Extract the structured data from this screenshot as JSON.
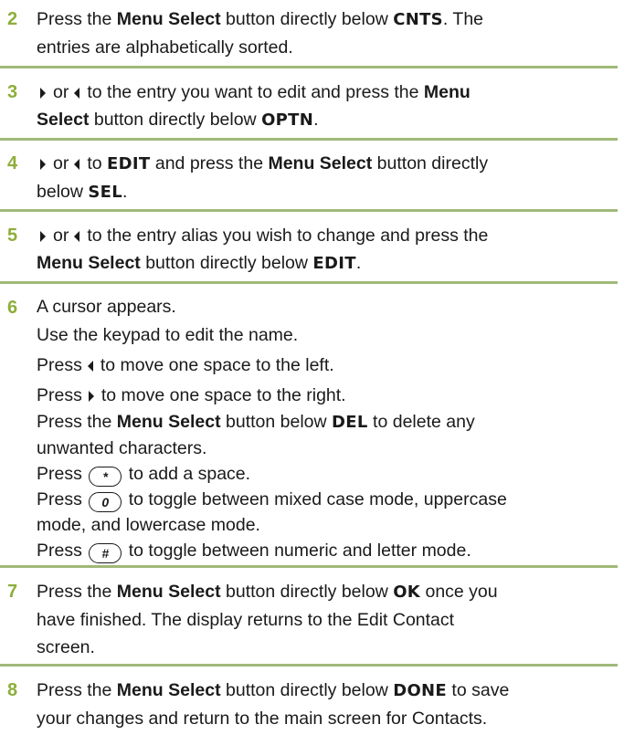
{
  "steps": {
    "s2": {
      "num": "2",
      "a": "Press the ",
      "b": "Menu Select",
      "c": " button directly below ",
      "d": "CNTS",
      "e": ". The",
      "f": "entries are alphabetically sorted."
    },
    "s3": {
      "num": "3",
      "a": "or",
      "b": "to the entry you want to edit and press the ",
      "c": "Menu",
      "d": "Select",
      "e": " button directly below ",
      "f": "OPTN",
      "g": "."
    },
    "s4": {
      "num": "4",
      "a": "or",
      "b": "to ",
      "c": "EDIT",
      "d": " and press the ",
      "e": "Menu Select",
      "f": " button directly",
      "g": "below ",
      "h": "SEL",
      "i": "."
    },
    "s5": {
      "num": "5",
      "a": "or",
      "b": "to the entry alias you wish to change and press the",
      "c": "Menu Select",
      "d": " button directly below ",
      "e": "EDIT",
      "f": "."
    },
    "s6": {
      "num": "6",
      "l1": "A cursor appears.",
      "l2": "Use the keypad to edit the name.",
      "l3a": "Press",
      "l3b": "to move one space to the left.",
      "l4a": "Press",
      "l4b": "to move one space to the right.",
      "l5a": "Press the ",
      "l5b": "Menu Select",
      "l5c": " button below ",
      "l5d": "DEL",
      "l5e": " to delete any",
      "l6": "unwanted characters.",
      "l7a": "Press",
      "l7key": "*",
      "l7b": "to add a space.",
      "l8a": "Press",
      "l8key": "0",
      "l8b": "to toggle between mixed case mode, uppercase",
      "l9": "mode, and lowercase mode.",
      "l10a": "Press",
      "l10key": "#",
      "l10b": "to toggle between numeric and letter mode."
    },
    "s7": {
      "num": "7",
      "a": "Press the ",
      "b": "Menu Select",
      "c": " button directly below ",
      "d": "OK",
      "e": " once you",
      "f": "have finished. The display returns to the Edit Contact",
      "g": "screen."
    },
    "s8": {
      "num": "8",
      "a": "Press the ",
      "b": "Menu Select",
      "c": " button directly below ",
      "d": "DONE",
      "e": " to save",
      "f": "your changes and return to the main screen for Contacts."
    }
  },
  "icons": {
    "right_arrow": "right-arrow",
    "left_arrow": "left-arrow",
    "accent_color": "#8dae3a",
    "rule_color": "#a0b979"
  }
}
